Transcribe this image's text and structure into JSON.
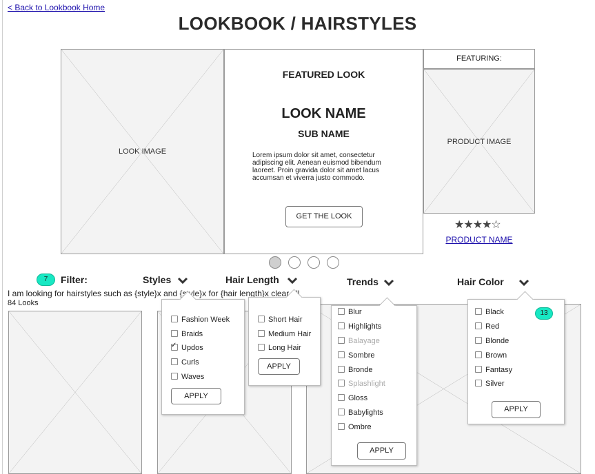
{
  "nav": {
    "back_link": "< Back to Lookbook Home"
  },
  "header": {
    "title": "LOOKBOOK / HAIRSTYLES"
  },
  "hero": {
    "look_image_label": "LOOK IMAGE",
    "featured_heading": "FEATURED LOOK",
    "look_name": "LOOK NAME",
    "sub_name": "SUB NAME",
    "description": "Lorem ipsum dolor sit amet, consectetur adipiscing elit. Aenean euismod bibendum laoreet. Proin gravida dolor sit amet lacus accumsan et viverra justo commodo.",
    "cta_label": "GET THE LOOK",
    "featuring_label": "FEATURING:",
    "product_image_label": "PRODUCT IMAGE",
    "rating": "★★★★☆",
    "product_name": "PRODUCT NAME"
  },
  "carousel": {
    "dots": 4,
    "active_index": 0
  },
  "filter": {
    "badge_count": "7",
    "label": "Filter:",
    "sentence": "I am looking for hairstyles such as {style}x and {style}x for {hair length}x clear all",
    "result_count": "84 Looks"
  },
  "dropdowns": {
    "styles": {
      "label": "Styles",
      "apply_label": "APPLY",
      "options": [
        {
          "label": "Fashion Week",
          "checked": false
        },
        {
          "label": "Braids",
          "checked": false
        },
        {
          "label": "Updos",
          "checked": true
        },
        {
          "label": "Curls",
          "checked": false
        },
        {
          "label": "Waves",
          "checked": false
        }
      ]
    },
    "hair_length": {
      "label": "Hair Length",
      "apply_label": "APPLY",
      "options": [
        {
          "label": "Short Hair",
          "checked": false
        },
        {
          "label": "Medium Hair",
          "checked": false
        },
        {
          "label": "Long Hair",
          "checked": false
        }
      ]
    },
    "trends": {
      "label": "Trends",
      "apply_label": "APPLY",
      "options": [
        {
          "label": "Blur",
          "disabled": false
        },
        {
          "label": "Highlights",
          "disabled": false
        },
        {
          "label": "Balayage",
          "disabled": true
        },
        {
          "label": "Sombre",
          "disabled": false
        },
        {
          "label": "Bronde",
          "disabled": false
        },
        {
          "label": "Splashlight",
          "disabled": true
        },
        {
          "label": "Gloss",
          "disabled": false
        },
        {
          "label": "Babylights",
          "disabled": false
        },
        {
          "label": "Ombre",
          "disabled": false
        }
      ]
    },
    "hair_color": {
      "label": "Hair Color",
      "apply_label": "APPLY",
      "badge_count": "13",
      "options": [
        {
          "label": "Black",
          "checked": false
        },
        {
          "label": "Red",
          "checked": false
        },
        {
          "label": "Blonde",
          "checked": false
        },
        {
          "label": "Brown",
          "checked": false
        },
        {
          "label": "Fantasy",
          "checked": false
        },
        {
          "label": "Silver",
          "checked": false
        }
      ]
    }
  },
  "colors": {
    "badge": "#17e8c3",
    "link": "#1a0dab",
    "placeholder_fill": "#f3f3f3",
    "placeholder_stroke": "#9a9a9a"
  }
}
